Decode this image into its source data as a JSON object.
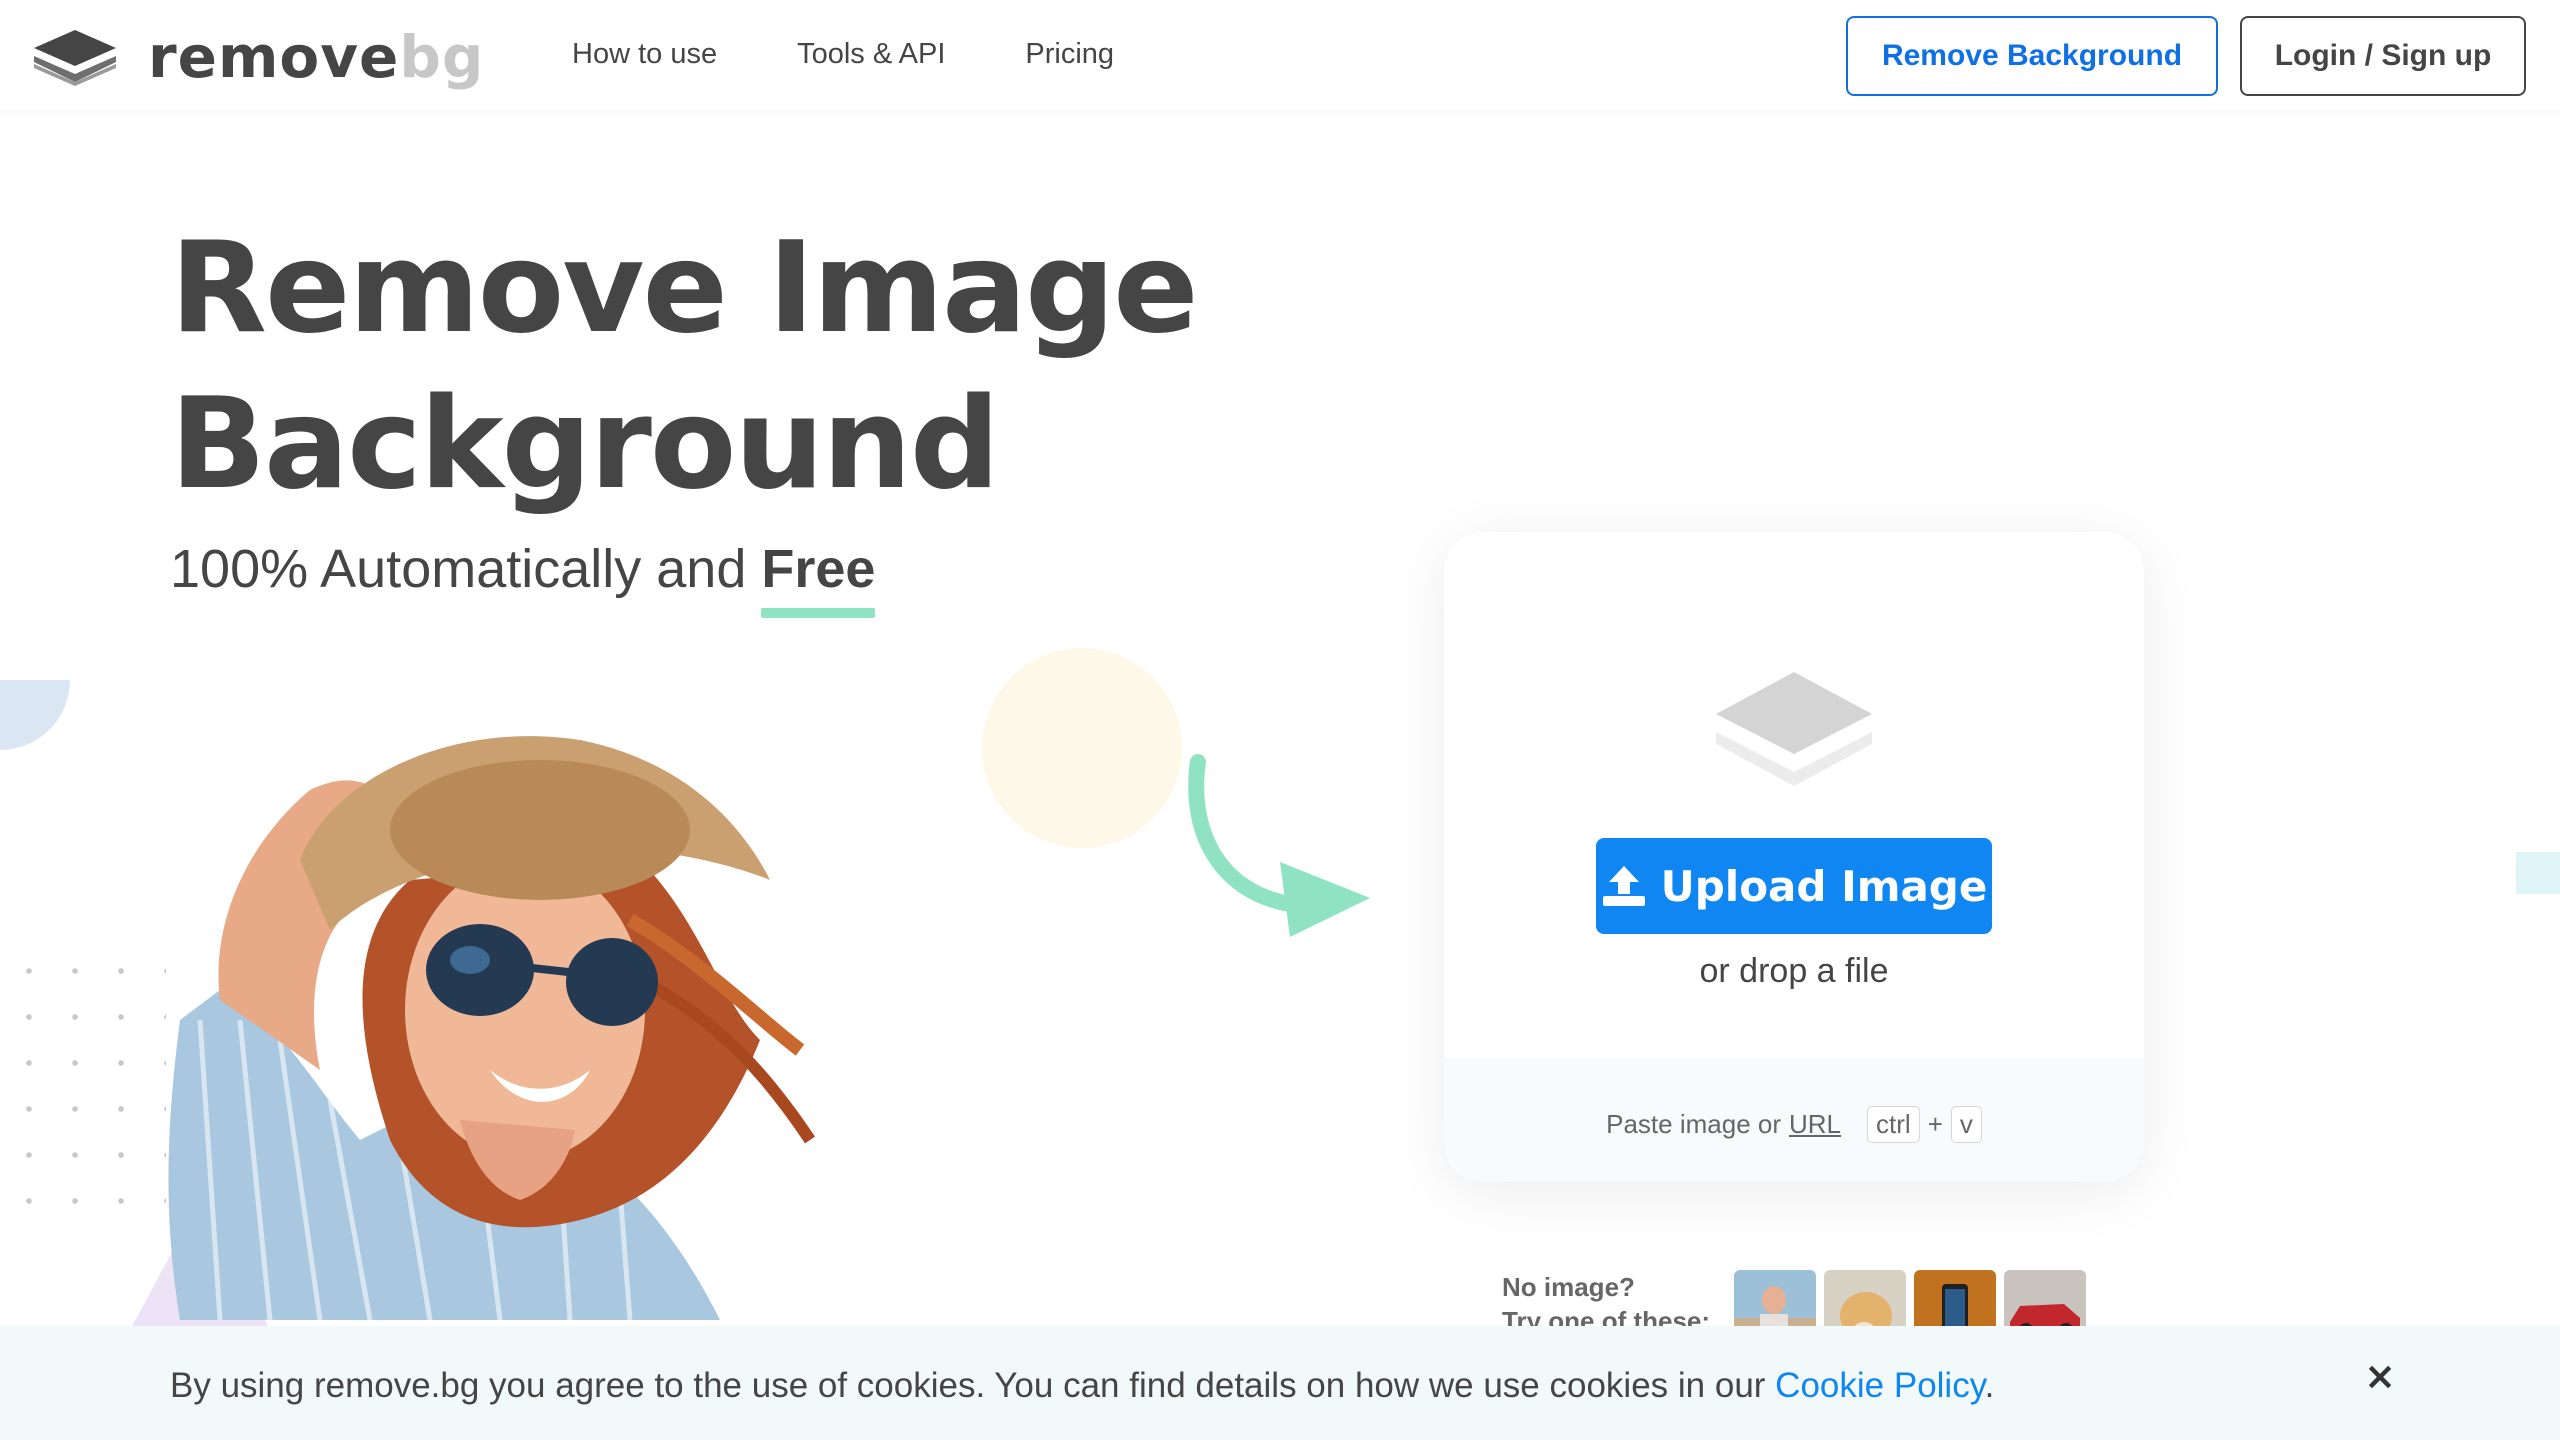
{
  "header": {
    "logo": {
      "word1": "remove",
      "word2": "bg"
    },
    "nav": [
      {
        "label": "How to use"
      },
      {
        "label": "Tools & API"
      },
      {
        "label": "Pricing"
      }
    ],
    "remove_bg_button": "Remove Background",
    "login_button": "Login / Sign up"
  },
  "hero": {
    "title_line1": "Remove Image",
    "title_line2": "Background",
    "subtitle_prefix": "100% Automatically and ",
    "subtitle_free": "Free"
  },
  "upload": {
    "button_label": "Upload Image",
    "drop_text": "or drop a file",
    "paste_text": "Paste image or ",
    "url_link": "URL",
    "key_ctrl": "ctrl",
    "key_plus": "+",
    "key_v": "v"
  },
  "samples": {
    "line1": "No image?",
    "line2": "Try one of these:"
  },
  "cookie": {
    "text": "By using remove.bg you agree to the use of cookies. You can find details on how we use cookies in our ",
    "link": "Cookie Policy",
    "suffix": ".",
    "close": "×"
  },
  "colors": {
    "brand_blue": "#0f86f2",
    "text_dark": "#454545",
    "accent_green": "#8fe3c2"
  }
}
